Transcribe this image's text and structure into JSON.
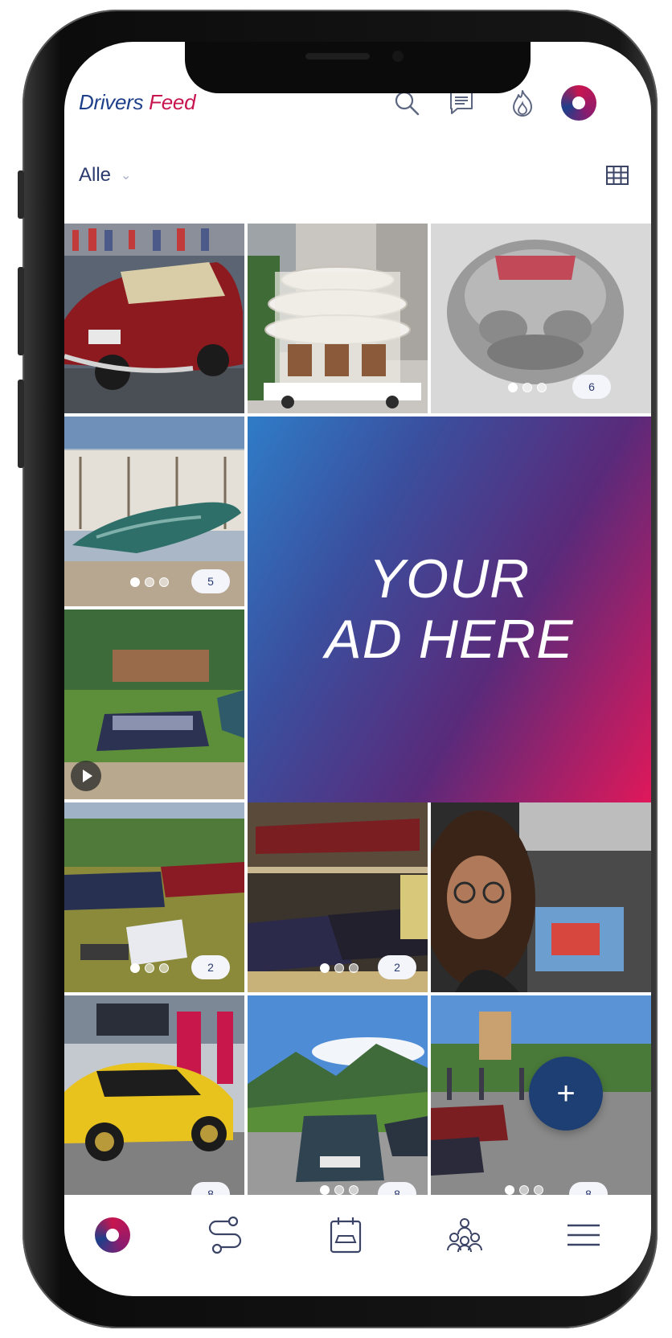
{
  "app": {
    "title_part1": "Drivers",
    "title_part2": "Feed"
  },
  "header_icons": [
    "search-icon",
    "chat-icon",
    "fire-icon",
    "profile-logo"
  ],
  "filter": {
    "selected": "Alle"
  },
  "colors": {
    "brand_blue": "#1e3f8a",
    "brand_pink": "#c8154f",
    "fab": "#1e3f73"
  },
  "feed": {
    "ad_line1": "YOUR",
    "ad_line2": "AD HERE",
    "tiles": [
      {
        "subject": "red classic car",
        "count": ""
      },
      {
        "subject": "round building",
        "count": ""
      },
      {
        "subject": "silver sculpture car",
        "count": "6"
      },
      {
        "subject": "green boat car",
        "count": "5"
      },
      {
        "subject": "dark sports car on grass",
        "count": ""
      },
      {
        "subject": "cars at meetup",
        "count": "2"
      },
      {
        "subject": "cars in garage",
        "count": "2"
      },
      {
        "subject": "woman selfie",
        "count": ""
      },
      {
        "subject": "yellow sports car",
        "count": "8"
      },
      {
        "subject": "car in mountains",
        "count": "8"
      },
      {
        "subject": "town street cars",
        "count": "8"
      }
    ]
  },
  "fab_label": "+",
  "bottom_nav": [
    "home-logo",
    "route-icon",
    "calendar-car-icon",
    "community-icon",
    "menu-icon"
  ]
}
